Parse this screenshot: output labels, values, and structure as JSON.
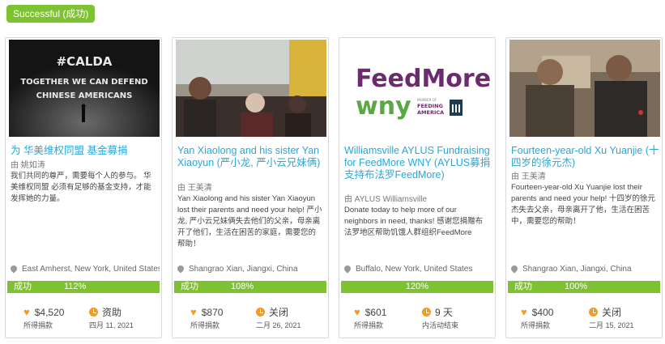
{
  "status_badge": "Successful (成功)",
  "cards": [
    {
      "image": {
        "lines": [
          "#CALDA",
          "TOGETHER WE CAN DEFEND",
          "CHINESE AMERICANS"
        ]
      },
      "title": "为 华美维权同盟 基金募捐",
      "author": "由 姚如涛",
      "description": "我们共同的尊严，需要每个人的参与。 华美维权同盟 必须有足够的基金支持，才能发挥她的力量。",
      "location": "East Amherst, New York, United States",
      "status": "成功",
      "percent": "112%",
      "amount": "$4,520",
      "amount_label": "所得捐款",
      "time_value": "资助",
      "time_label": "四月 11, 2021"
    },
    {
      "title": "Yan Xiaolong and his sister Yan Xiaoyun (严小龙, 严小云兄妹俩)",
      "author": "由 王美清",
      "description": "Yan Xiaolong and his sister Yan Xiaoyun lost their parents and need your help! 严小龙, 严小云兄妹俩失去他们的父亲，母亲离开了他们，生活在困苦的家庭，需要您的帮助！",
      "location": "Shangrao Xian, Jiangxi, China",
      "status": "成功",
      "percent": "108%",
      "amount": "$870",
      "amount_label": "所得捐款",
      "time_value": "关闭",
      "time_label": "二月 26, 2021"
    },
    {
      "image": {
        "logo_line1": "FeedMore",
        "logo_line2": "wny",
        "partner_small": "MEMBER OF",
        "partner_main": "FEEDING",
        "partner_sub": "AMERICA"
      },
      "title": "Williamsville AYLUS Fundraising for FeedMore WNY (AYLUS募捐支持布法罗FeedMore)",
      "author": "由 AYLUS Williamsville",
      "description": "Donate today to help more of our neighbors in need, thanks! 感谢您捐赠布法罗地区帮助饥饿人群组织FeedMore",
      "location": "Buffalo, New York, United States",
      "status": "",
      "percent": "120%",
      "amount": "$601",
      "amount_label": "所得捐款",
      "time_value": "9 天",
      "time_label": "内活动结束"
    },
    {
      "title": "Fourteen-year-old Xu Yuanjie (十四岁的徐元杰)",
      "author": "由 王美清",
      "description": "Fourteen-year-old Xu Yuanjie lost their parents and need your help! 十四岁的徐元杰失去父亲，母亲离开了他，生活在困苦中，需要您的帮助！",
      "location": "Shangrao Xian, Jiangxi, China",
      "status": "成功",
      "percent": "100%",
      "amount": "$400",
      "amount_label": "所得捐款",
      "time_value": "关闭",
      "time_label": "二月 15, 2021"
    }
  ],
  "colors": {
    "accent": "#7ec232",
    "link": "#2aa7d8",
    "icon": "#f59a23",
    "feedmore_purple": "#6b2c6e",
    "feedmore_green": "#5aa845"
  }
}
